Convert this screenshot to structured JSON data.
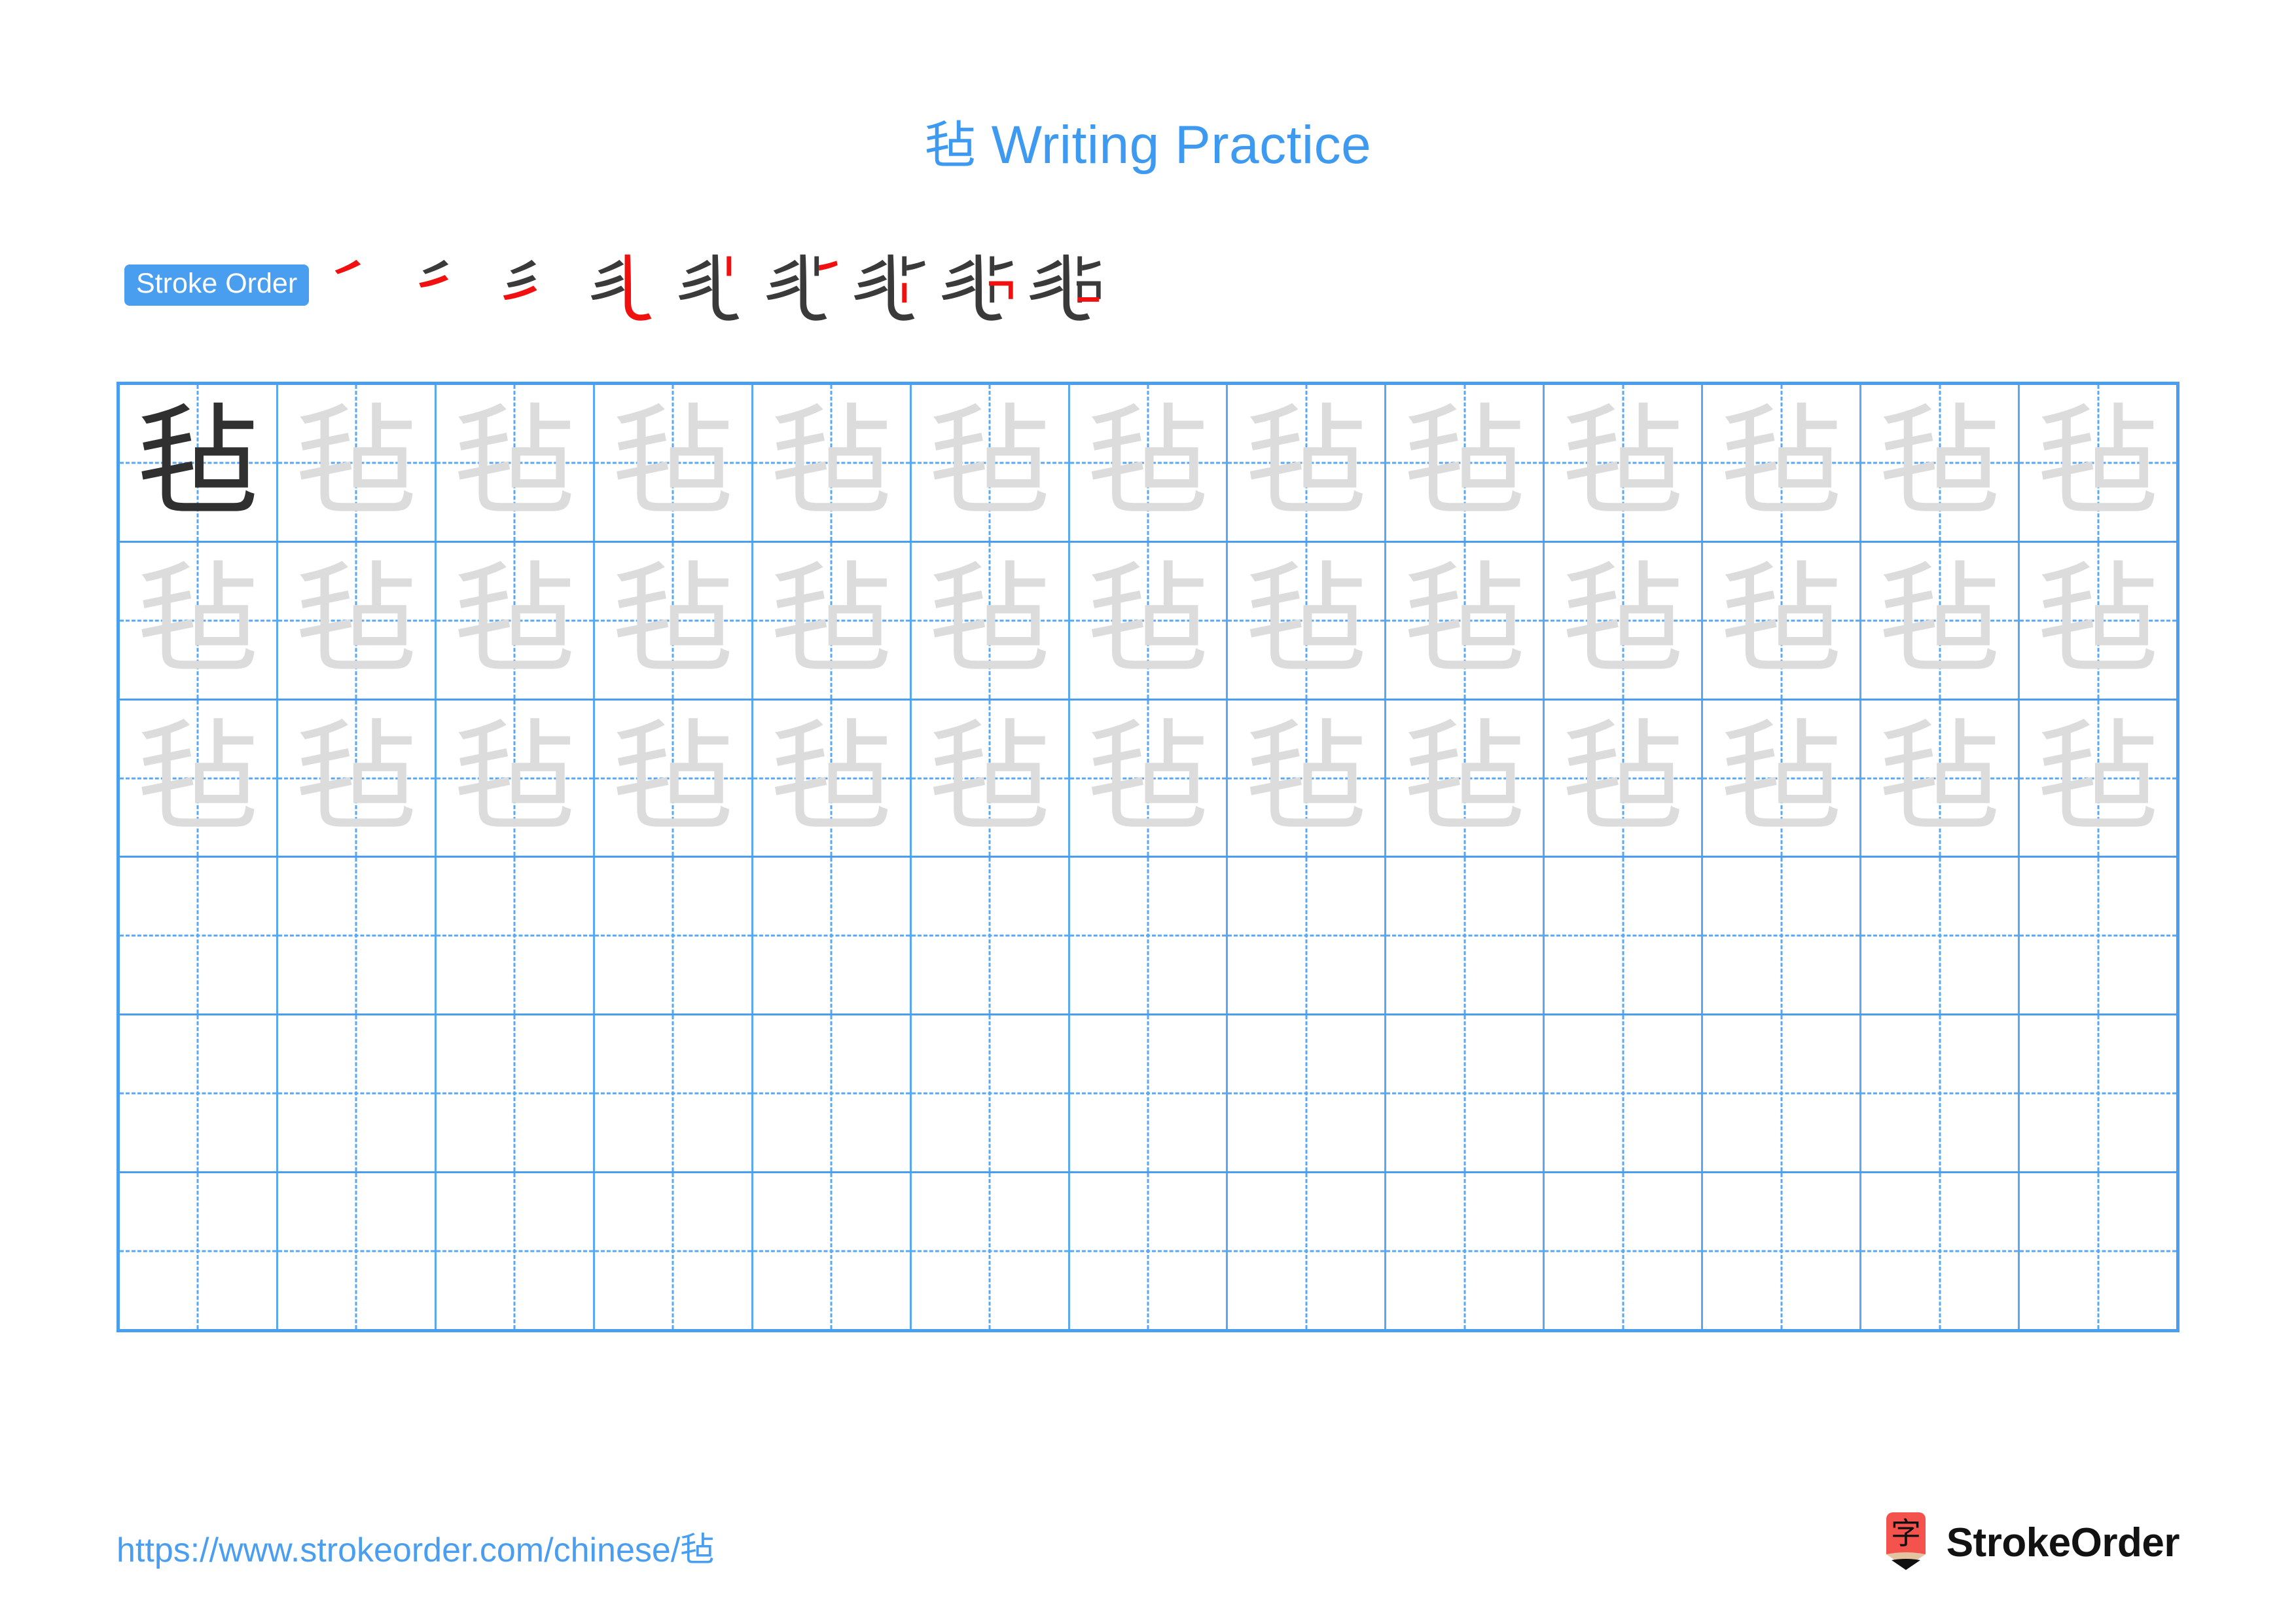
{
  "header": {
    "character": "毡",
    "title_suffix": " Writing Practice",
    "title_color": "#3d9af0"
  },
  "stroke_order": {
    "badge_label": "Stroke Order",
    "badge_bg": "#4a9ef0",
    "badge_text_color": "#ffffff",
    "total_strokes": 9,
    "new_stroke_color": "#f01010",
    "prior_stroke_color": "#3a3a3a",
    "steps": [
      {
        "step": 1,
        "name": "stroke-step-1",
        "strokes_shown": 1
      },
      {
        "step": 2,
        "name": "stroke-step-2",
        "strokes_shown": 2
      },
      {
        "step": 3,
        "name": "stroke-step-3",
        "strokes_shown": 3
      },
      {
        "step": 4,
        "name": "stroke-step-4",
        "strokes_shown": 4
      },
      {
        "step": 5,
        "name": "stroke-step-5",
        "strokes_shown": 5
      },
      {
        "step": 6,
        "name": "stroke-step-6",
        "strokes_shown": 6
      },
      {
        "step": 7,
        "name": "stroke-step-7",
        "strokes_shown": 7
      },
      {
        "step": 8,
        "name": "stroke-step-8",
        "strokes_shown": 8
      },
      {
        "step": 9,
        "name": "stroke-step-9",
        "strokes_shown": 9
      }
    ]
  },
  "practice_grid": {
    "columns": 13,
    "rows": 6,
    "grid_line_color": "#4a9ef0",
    "dashed_line_color": "#5aa7f2",
    "traced_color": "#dcdcdc",
    "model_color": "#303030",
    "cells": [
      [
        "毡",
        "毡",
        "毡",
        "毡",
        "毡",
        "毡",
        "毡",
        "毡",
        "毡",
        "毡",
        "毡",
        "毡",
        "毡"
      ],
      [
        "毡",
        "毡",
        "毡",
        "毡",
        "毡",
        "毡",
        "毡",
        "毡",
        "毡",
        "毡",
        "毡",
        "毡",
        "毡"
      ],
      [
        "毡",
        "毡",
        "毡",
        "毡",
        "毡",
        "毡",
        "毡",
        "毡",
        "毡",
        "毡",
        "毡",
        "毡",
        "毡"
      ],
      [
        "",
        "",
        "",
        "",
        "",
        "",
        "",
        "",
        "",
        "",
        "",
        "",
        ""
      ],
      [
        "",
        "",
        "",
        "",
        "",
        "",
        "",
        "",
        "",
        "",
        "",
        "",
        ""
      ],
      [
        "",
        "",
        "",
        "",
        "",
        "",
        "",
        "",
        "",
        "",
        "",
        "",
        ""
      ]
    ],
    "model_cell": {
      "row": 0,
      "col": 0
    }
  },
  "footer": {
    "url": "https://www.strokeorder.com/chinese/毡",
    "url_color": "#4a9ef0",
    "brand_name": "StrokeOrder",
    "logo_character": "字",
    "logo_bg_color": "#f4534d",
    "logo_wood_color": "#e3c3a0",
    "logo_tip_color": "#101010"
  }
}
